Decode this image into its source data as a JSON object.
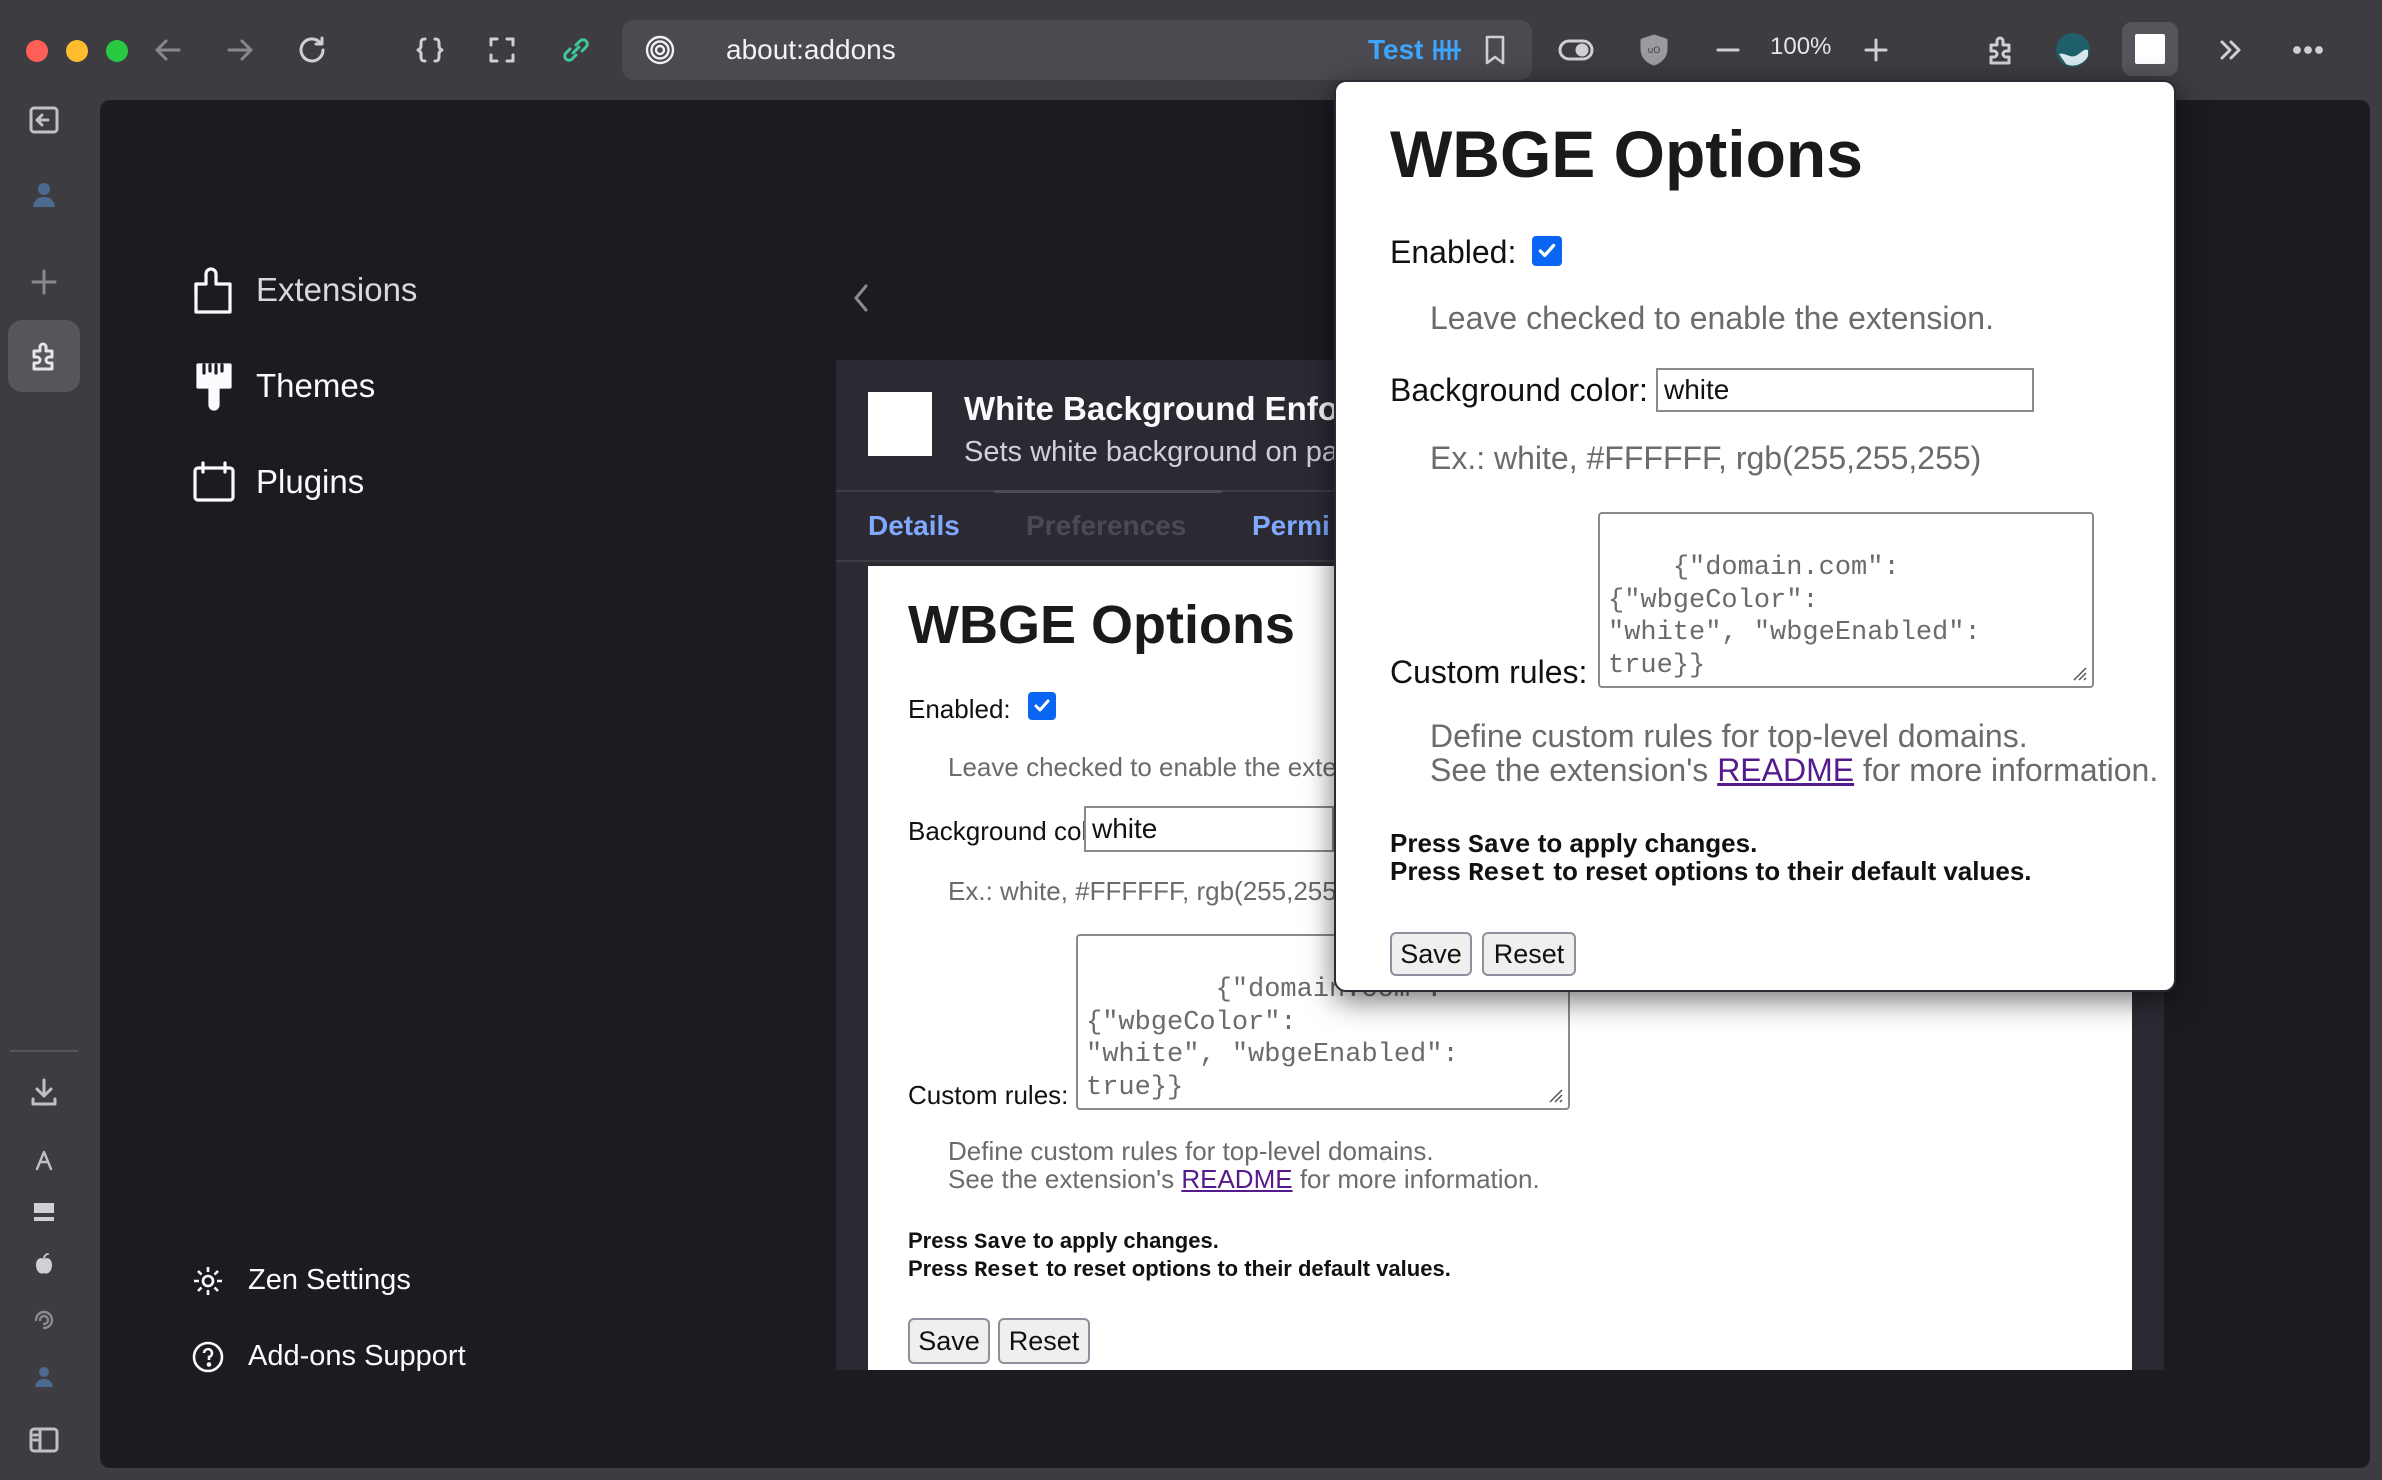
{
  "browser": {
    "url": "about:addons",
    "url_badge": "Test",
    "zoom": "100%"
  },
  "sidebar": {
    "categories": [
      {
        "label": "Extensions",
        "icon": "puzzle-icon"
      },
      {
        "label": "Themes",
        "icon": "paintbrush-icon"
      },
      {
        "label": "Plugins",
        "icon": "plugin-icon"
      }
    ],
    "footer": [
      {
        "label": "Zen Settings",
        "icon": "gear-icon"
      },
      {
        "label": "Add-ons Support",
        "icon": "help-icon"
      }
    ]
  },
  "extension": {
    "name": "White Background Enfor",
    "description": "Sets white background on pa",
    "tabs": [
      "Details",
      "Preferences",
      "Permi"
    ]
  },
  "options": {
    "title": "WBGE Options",
    "enabled_label": "Enabled:",
    "enabled": true,
    "enabled_hint": "Leave checked to enable the extension.",
    "enabled_hint_clipped": "Leave checked to enable the exte",
    "bg_label": "Background color:",
    "bg_value": "white",
    "bg_hint": "Ex.: white, #FFFFFF, rgb(255,255,255)",
    "bg_hint_clipped": "Ex.: white, #FFFFFF, rgb(255,255",
    "rules_label": "Custom rules:",
    "rules_value": "{\"domain.com\":{\"wbgeColor\":\n\"white\", \"wbgeEnabled\": true}}",
    "rules_hint_1": "Define custom rules for top-level domains.",
    "rules_hint_2_prefix": "See the extension's ",
    "rules_hint_2_link": "README",
    "rules_hint_2_suffix": " for more information.",
    "press": "Press ",
    "save_code": "Save",
    "save_suffix": " to apply changes.",
    "reset_code": "Reset",
    "reset_suffix": " to reset options to their default values.",
    "save_button": "Save",
    "reset_button": "Reset"
  },
  "colors": {
    "accent": "#0a66f2",
    "tab_active": "#80a8ff",
    "link": "#551a8b"
  }
}
